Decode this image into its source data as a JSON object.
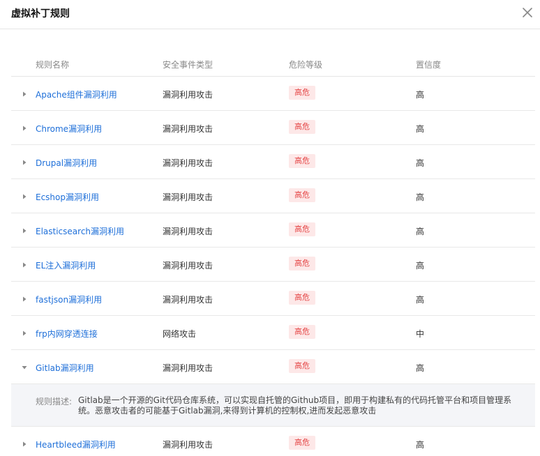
{
  "dialog": {
    "title": "虚拟补丁规则"
  },
  "columns": [
    "规则名称",
    "安全事件类型",
    "危险等级",
    "置信度"
  ],
  "rows": [
    {
      "name": "Apache组件漏洞利用",
      "type": "漏洞利用攻击",
      "level": "高危",
      "confidence": "高",
      "expanded": false
    },
    {
      "name": "Chrome漏洞利用",
      "type": "漏洞利用攻击",
      "level": "高危",
      "confidence": "高",
      "expanded": false
    },
    {
      "name": "Drupal漏洞利用",
      "type": "漏洞利用攻击",
      "level": "高危",
      "confidence": "高",
      "expanded": false
    },
    {
      "name": "Ecshop漏洞利用",
      "type": "漏洞利用攻击",
      "level": "高危",
      "confidence": "高",
      "expanded": false
    },
    {
      "name": "Elasticsearch漏洞利用",
      "type": "漏洞利用攻击",
      "level": "高危",
      "confidence": "高",
      "expanded": false
    },
    {
      "name": "EL注入漏洞利用",
      "type": "漏洞利用攻击",
      "level": "高危",
      "confidence": "高",
      "expanded": false
    },
    {
      "name": "fastjson漏洞利用",
      "type": "漏洞利用攻击",
      "level": "高危",
      "confidence": "高",
      "expanded": false
    },
    {
      "name": "frp内网穿透连接",
      "type": "网络攻击",
      "level": "高危",
      "confidence": "中",
      "expanded": false
    },
    {
      "name": "Gitlab漏洞利用",
      "type": "漏洞利用攻击",
      "level": "高危",
      "confidence": "高",
      "expanded": true,
      "description_label": "规则描述:",
      "description": "Gitlab是一个开源的Git代码仓库系统，可以实现自托管的Github项目，即用于构建私有的代码托管平台和项目管理系统。恶意攻击者的可能基于Gitlab漏洞,来得到计算机的控制权,进而发起恶意攻击"
    },
    {
      "name": "Heartbleed漏洞利用",
      "type": "漏洞利用攻击",
      "level": "高危",
      "confidence": "高",
      "expanded": false
    }
  ],
  "colors": {
    "link": "#1e6fd9",
    "badge_bg": "#fde8e8",
    "badge_text": "#e54545"
  },
  "icons": {
    "close": "close-icon",
    "collapsed": "caret-right-icon",
    "expanded": "caret-down-icon"
  }
}
